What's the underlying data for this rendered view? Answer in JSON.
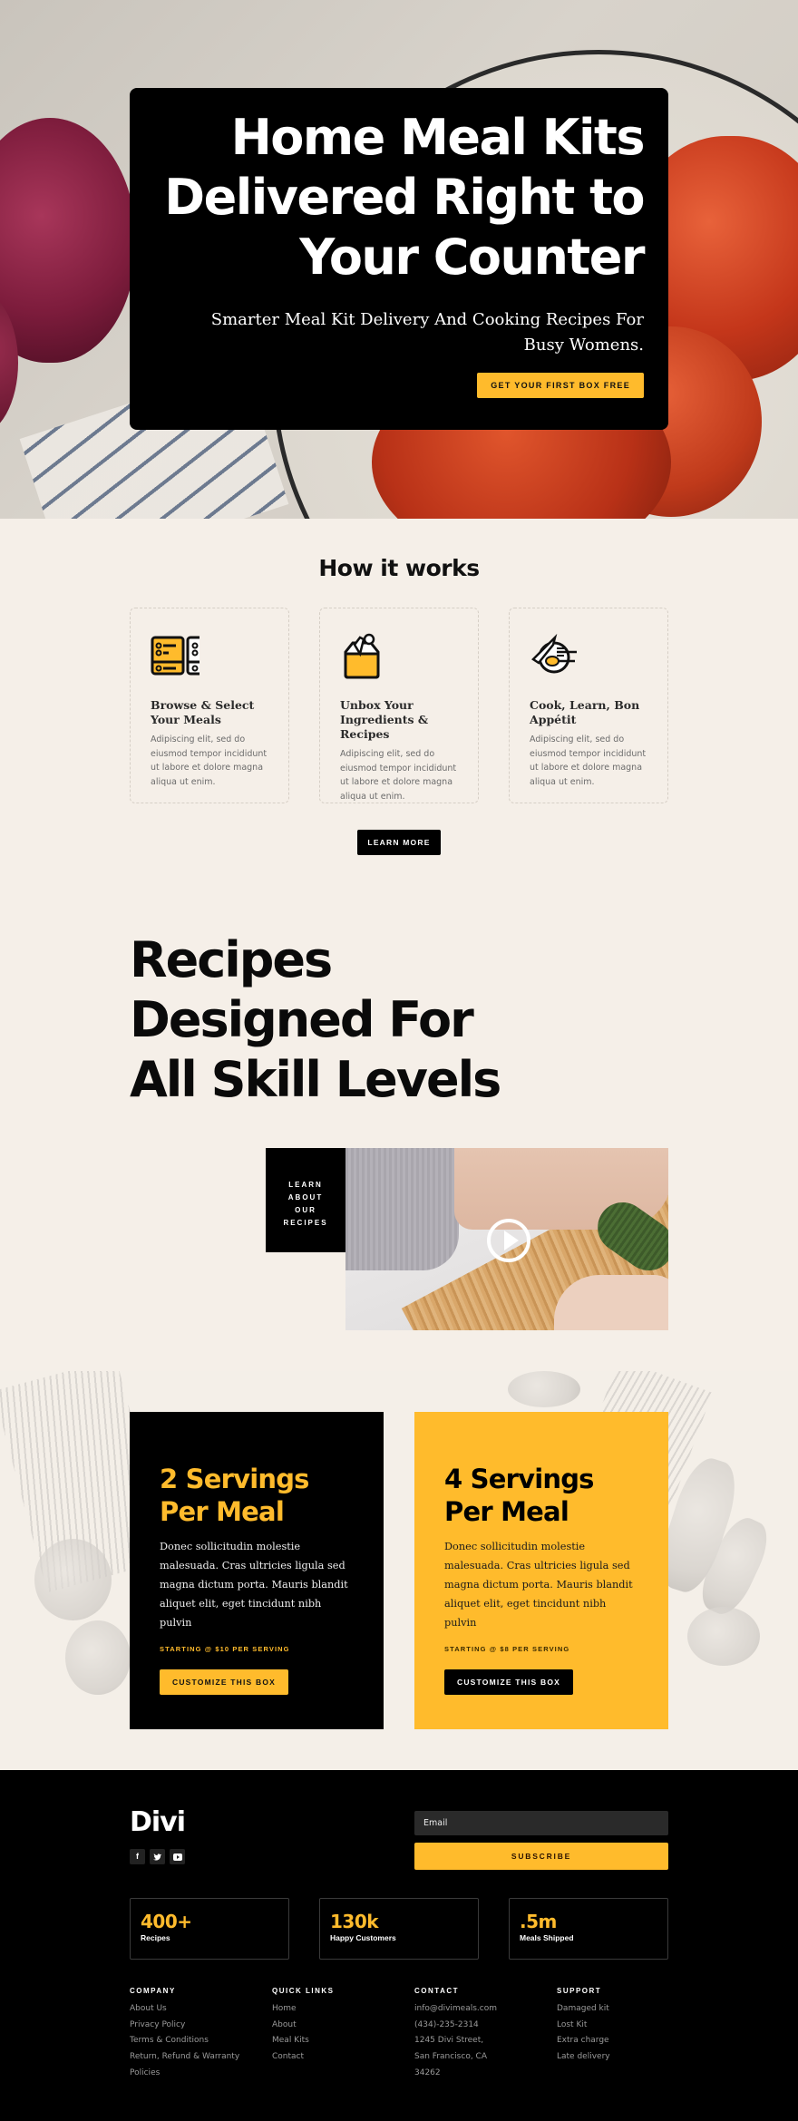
{
  "colors": {
    "accent": "#ffbb2c",
    "dark": "#000000",
    "background": "#f5efe8"
  },
  "hero": {
    "title": "Home Meal Kits Delivered Right to Your Counter",
    "subtitle": "Smarter Meal Kit Delivery And Cooking Recipes For Busy Womens.",
    "cta_label": "GET YOUR FIRST BOX FREE"
  },
  "how_it_works": {
    "title": "How it works",
    "steps": [
      {
        "icon": "menu-list-icon",
        "title": "Browse & Select Your Meals",
        "text": "Adipiscing elit, sed do eiusmod tempor incididunt ut labore et dolore magna aliqua ut enim."
      },
      {
        "icon": "grocery-bag-icon",
        "title": "Unbox Your Ingredients & Recipes",
        "text": "Adipiscing elit, sed do eiusmod tempor incididunt ut labore et dolore magna aliqua ut enim."
      },
      {
        "icon": "plate-cutlery-icon",
        "title": "Cook, Learn, Bon Appétit",
        "text": "Adipiscing elit, sed do eiusmod tempor incididunt ut labore et dolore magna aliqua ut enim."
      }
    ],
    "button_label": "LEARN MORE"
  },
  "recipes": {
    "title_lines": [
      "Recipes",
      "Designed For",
      "All Skill Levels"
    ],
    "video_label_lines": [
      "LEARN",
      "ABOUT",
      "OUR",
      "RECIPES"
    ],
    "video_icon": "play-icon"
  },
  "pricing": [
    {
      "title": "2 Servings Per Meal",
      "text": "Donec sollicitudin molestie malesuada. Cras ultricies ligula sed magna dictum porta. Mauris blandit aliquet elit, eget tincidunt nibh pulvin",
      "starting": "STARTING @ $10 PER SERVING",
      "button_label": "CUSTOMIZE THIS BOX"
    },
    {
      "title": "4 Servings Per Meal",
      "text": "Donec sollicitudin molestie malesuada. Cras ultricies ligula sed magna dictum porta. Mauris blandit aliquet elit, eget tincidunt nibh pulvin",
      "starting": "STARTING @ $8 PER SERVING",
      "button_label": "CUSTOMIZE THIS BOX"
    }
  ],
  "footer": {
    "logo": "Divi",
    "social": [
      {
        "name": "facebook-icon",
        "glyph": "f"
      },
      {
        "name": "twitter-icon",
        "glyph": "t"
      },
      {
        "name": "youtube-icon",
        "glyph": "▶"
      }
    ],
    "email_placeholder": "Email",
    "subscribe_label": "SUBSCRIBE",
    "stats": [
      {
        "value": "400+",
        "label": "Recipes"
      },
      {
        "value": "130k",
        "label": "Happy Customers"
      },
      {
        "value": ".5m",
        "label": "Meals Shipped"
      }
    ],
    "columns": [
      {
        "title": "COMPANY",
        "links": [
          "About Us",
          "Privacy Policy",
          "Terms & Conditions",
          "Return, Refund & Warranty Policies"
        ]
      },
      {
        "title": "QUICK LINKS",
        "links": [
          "Home",
          "About",
          "Meal Kits",
          "Contact"
        ]
      },
      {
        "title": "CONTACT",
        "links": [
          "info@divimeals.com",
          "(434)-235-2314",
          "1245 Divi Street, San Francisco, CA 34262"
        ]
      },
      {
        "title": "SUPPORT",
        "links": [
          "Damaged kit",
          "Lost Kit",
          "Extra charge",
          "Late delivery"
        ]
      }
    ]
  }
}
